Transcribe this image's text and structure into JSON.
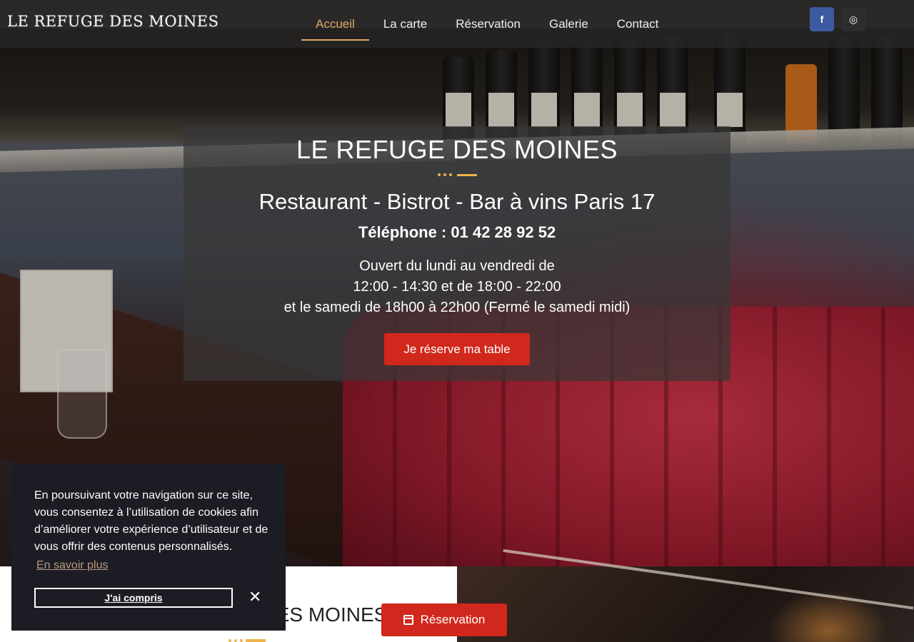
{
  "header": {
    "logo": "LE REFUGE DES MOINES",
    "nav": [
      {
        "label": "Accueil",
        "active": true
      },
      {
        "label": "La carte"
      },
      {
        "label": "Réservation"
      },
      {
        "label": "Galerie"
      },
      {
        "label": "Contact"
      }
    ],
    "social": [
      {
        "icon": "facebook-icon",
        "glyph": "f"
      },
      {
        "icon": "instagram-icon",
        "glyph": "◎"
      }
    ]
  },
  "hero": {
    "title": "LE REFUGE DES MOINES",
    "subtitle": "Restaurant - Bistrot - Bar à vins Paris 17",
    "phone": "Téléphone : 01 42 28 92 52",
    "hours_line1": "Ouvert du lundi au vendredi de",
    "hours_line2": "12:00 - 14:30 et de 18:00 - 22:00",
    "hours_line3": "et le samedi de 18h00 à 22h00 (Fermé le samedi midi)",
    "cta": "Je réserve ma table"
  },
  "section": {
    "title": "LE REFUGE DES MOINES",
    "reservation_button": "Réservation"
  },
  "cookie": {
    "text": "En poursuivant votre navigation sur ce site, vous consentez à l’utilisation de cookies afin d’améliorer votre expérience d’utilisateur et de vous offrir des contenus personnalisés.",
    "learn_more": "En savoir plus",
    "accept": "J'ai compris",
    "close": "✕"
  },
  "colors": {
    "accent": "#e0a96a",
    "button_red": "#d0281c",
    "separator": "#f0b34a",
    "cookie_bg": "#1c1c24"
  }
}
